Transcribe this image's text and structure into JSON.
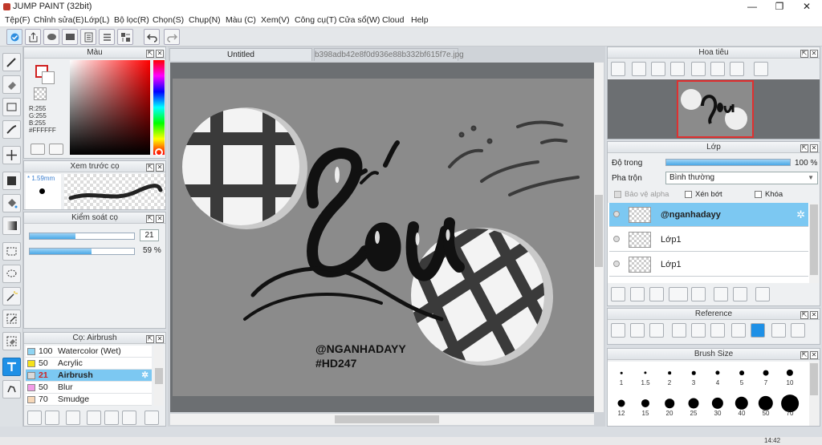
{
  "app": {
    "title": "JUMP PAINT (32bit)"
  },
  "menu": [
    "Tệp(F)",
    "Chỉnh sửa(E)",
    "Lớp(L)",
    "Bộ lọc(R)",
    "Chọn(S)",
    "Chụp(N)",
    "Màu (C)",
    "Xem(V)",
    "Công cụ(T)",
    "Cửa sổ(W)",
    "Cloud",
    "Help"
  ],
  "color_panel": {
    "title": "Màu",
    "r": "R:255",
    "g": "G:255",
    "b": "B:255",
    "hex": "#FFFFFF"
  },
  "preview_panel": {
    "title": "Xem trước cọ",
    "size": "1.59mm"
  },
  "brush_control": {
    "title": "Kiểm soát cọ",
    "size_value": "21",
    "opacity_value": "59",
    "opacity_unit": "%",
    "size_fraction": 0.44,
    "opacity_fraction": 0.59
  },
  "brush_list": {
    "title": "Cọ: Airbrush",
    "items": [
      {
        "num": "100",
        "name": "Watercolor (Wet)",
        "color": "#8fd4f2"
      },
      {
        "num": "50",
        "name": "Acrylic",
        "color": "#f5e11a"
      },
      {
        "num": "21",
        "name": "Airbrush",
        "color": "#d9d9d9"
      },
      {
        "num": "50",
        "name": "Blur",
        "color": "#f29be6"
      },
      {
        "num": "70",
        "name": "Smudge",
        "color": "#f7d8b8"
      }
    ]
  },
  "tabs": {
    "tab1": "Untitled",
    "tab2": "b398adb42e8f0d936e88b332bf615f7e.jpg"
  },
  "artwork": {
    "title_text": "Sầu",
    "handle": "@NGANHADAYY",
    "tag": "#HD247"
  },
  "navigator": {
    "title": "Hoa tiêu"
  },
  "layers": {
    "title": "Lớp",
    "opacity_label": "Độ trong",
    "opacity_value": "100",
    "opacity_unit": "%",
    "blend_label": "Pha trộn",
    "blend_value": "Bình thường",
    "alpha_lock": "Bảo vệ alpha",
    "clip": "Xén bớt",
    "lock": "Khóa",
    "items": [
      {
        "name": "@nganhadayy"
      },
      {
        "name": "Lớp1"
      },
      {
        "name": "Lớp1"
      }
    ]
  },
  "reference": {
    "title": "Reference"
  },
  "brush_size": {
    "title": "Brush Size",
    "row1": [
      "1",
      "1.5",
      "2",
      "3",
      "4",
      "5",
      "7",
      "10"
    ],
    "row2": [
      "12",
      "15",
      "20",
      "25",
      "30",
      "40",
      "50",
      "70"
    ]
  },
  "taskbar": {
    "time": "14:42"
  }
}
